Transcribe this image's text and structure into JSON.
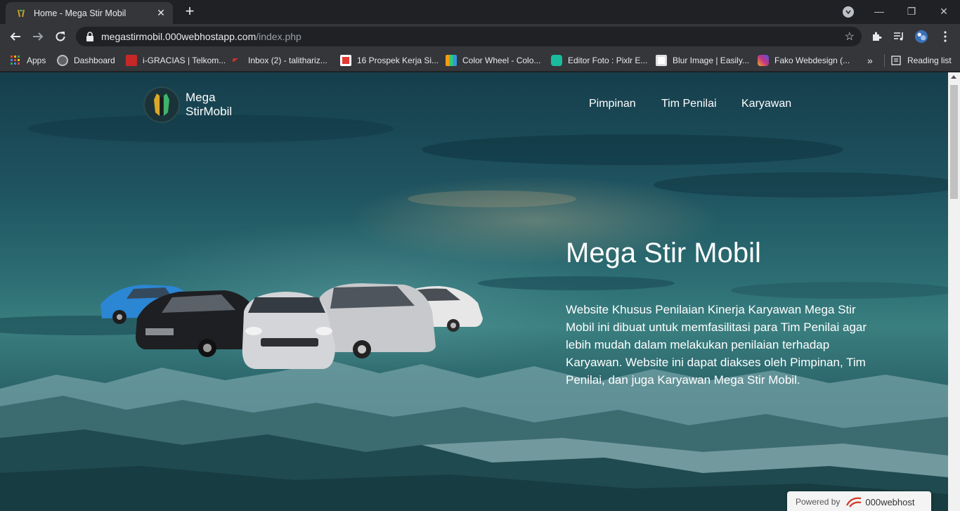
{
  "browser": {
    "tab_title": "Home - Mega Stir Mobil",
    "tab_close": "✕",
    "new_tab": "+",
    "url_host": "megastirmobil.000webhostapp.com",
    "url_path": "/index.php",
    "window_controls": [
      "—",
      "❐",
      "✕"
    ],
    "bookmarks": [
      {
        "label": "Apps",
        "icon": "apps-grid-icon",
        "color": "#e74c3c"
      },
      {
        "label": "Dashboard",
        "icon": "dashboard-icon",
        "color": "#9e9e9e"
      },
      {
        "label": "i-GRACIAS | Telkom...",
        "icon": "igracias-icon",
        "color": "#c62828"
      },
      {
        "label": "Inbox (2) - talithariz...",
        "icon": "mail-icon",
        "color": "#d32f2f"
      },
      {
        "label": "16 Prospek Kerja Si...",
        "icon": "home-icon",
        "color": "#e53935"
      },
      {
        "label": "Color Wheel - Colo...",
        "icon": "color-wheel-icon",
        "color": "#f39c12"
      },
      {
        "label": "Editor Foto : Pixlr E...",
        "icon": "pixlr-icon",
        "color": "#1abc9c"
      },
      {
        "label": "Blur Image | Easily...",
        "icon": "blur-icon",
        "color": "#ffffff"
      },
      {
        "label": "Fako Webdesign (...",
        "icon": "instagram-icon",
        "color": "#c13584"
      }
    ],
    "more": "»",
    "reading_list": "Reading list"
  },
  "site": {
    "brand_line1": "Mega",
    "brand_line2": "StirMobil",
    "nav": [
      "Pimpinan",
      "Tim Penilai",
      "Karyawan"
    ],
    "hero_title": "Mega Stir Mobil",
    "hero_desc": "Website Khusus Penilaian Kinerja Karyawan Mega Stir Mobil ini dibuat untuk memfasilitasi para Tim Penilai agar lebih mudah dalam melakukan penilaian terhadap Karyawan. Website ini dapat diakses oleh Pimpinan, Tim Penilai, dan juga Karyawan Mega Stir Mobil."
  },
  "footer_badge": {
    "label": "Powered by",
    "brand": "000webhost"
  }
}
